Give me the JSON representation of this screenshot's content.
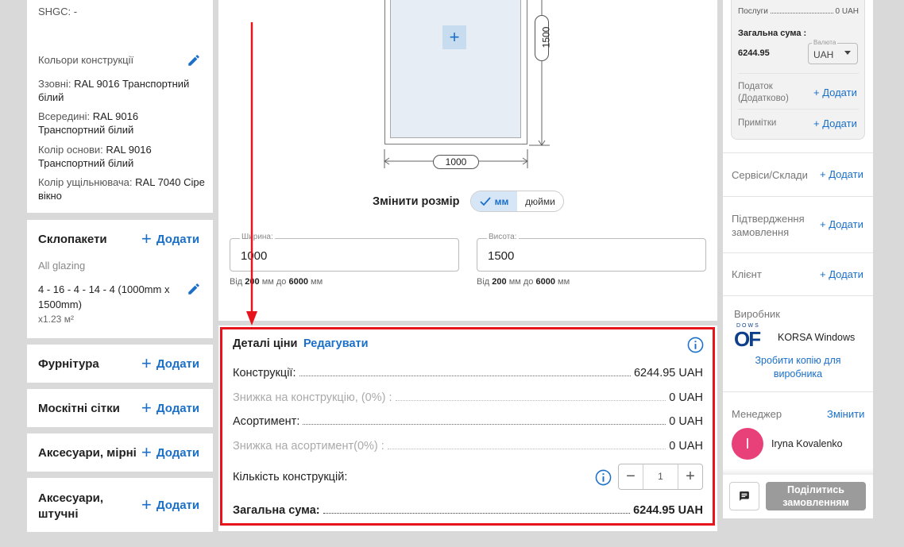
{
  "left": {
    "shgc": "SHGC: -",
    "colors": {
      "title": "Кольори конструкції",
      "outside_label": "Ззовні:",
      "outside_value": "RAL 9016 Транспортний",
      "outside_value2": "білий",
      "inside_label": "Всередині:",
      "inside_value": "RAL 9016",
      "inside_value2": "Транспортний білий",
      "base_label": "Колір основи:",
      "base_value": "RAL 9016",
      "base_value2": "Транспортний білий",
      "seal_label": "Колір ущільнювача:",
      "seal_value": "RAL 7040 Сіре",
      "seal_value2": "вікно"
    },
    "glazing": {
      "title": "Склопакети",
      "add": "Додати",
      "subtitle": "All glazing",
      "spec1": "4 - 16 - 4 - 14 - 4 (1000mm x",
      "spec2": "1500mm)",
      "qty": "x1.23 м²"
    },
    "hardware": {
      "title": "Фурнітура",
      "add": "Додати"
    },
    "mosquito": {
      "title": "Москітні сітки",
      "add": "Додати"
    },
    "acc_measured": {
      "title": "Аксесуари, мірні",
      "add": "Додати"
    },
    "acc_piece": {
      "title1": "Аксесуари,",
      "title2": "штучні",
      "add": "Додати"
    }
  },
  "center": {
    "dim_height": "1500",
    "dim_width": "1000",
    "resize_label": "Змінити розмір",
    "unit_mm": "мм",
    "unit_inch": "дюйми",
    "width_field": {
      "label": "Ширина:",
      "value": "1000",
      "hint_from": "Від",
      "hint_min": "200",
      "hint_mid": "мм до",
      "hint_max": "6000",
      "hint_unit": "мм"
    },
    "height_field": {
      "label": "Висота:",
      "value": "1500",
      "hint_from": "Від",
      "hint_min": "200",
      "hint_mid": "мм до",
      "hint_max": "6000",
      "hint_unit": "мм"
    },
    "price": {
      "title": "Деталі ціни",
      "edit": "Редагувати",
      "constructions_label": "Конструкції:",
      "constructions_value": "6244.95 UAH",
      "construction_discount_label": "Знижка на конструкцію, (0%) :",
      "construction_discount_value": "0 UAH",
      "assortment_label": "Асортимент:",
      "assortment_value": "0 UAH",
      "assortment_discount_label": "Знижка на асортимент(0%) :",
      "assortment_discount_value": "0 UAH",
      "quantity_label": "Кількість конструкцій:",
      "quantity_value": "1",
      "total_label": "Загальна сума:",
      "total_value": "6244.95 UAH"
    }
  },
  "right": {
    "services_label": "Послуги",
    "services_value": "0 UAH",
    "total_label": "Загальна сума :",
    "total_value": "6244.95",
    "currency_label": "Валюта",
    "currency_value": "UAH",
    "tax_label1": "Податок",
    "tax_label2": "(Додатково)",
    "tax_add": "+ Додати",
    "notes_label": "Примітки",
    "notes_add": "+ Додати",
    "services_warehouses": "Сервіси/Склади",
    "services_warehouses_add": "+ Додати",
    "order_confirm1": "Підтвердження",
    "order_confirm2": "замовлення",
    "order_confirm_add": "+ Додати",
    "client": "Клієнт",
    "client_add": "+ Додати",
    "manufacturer": "Виробник",
    "manufacturer_logo_top": "DOWS",
    "manufacturer_logo": "OF",
    "manufacturer_name": "KORSA Windows",
    "copy_link1": "Зробити копію для",
    "copy_link2": "виробника",
    "manager": "Менеджер",
    "manager_change": "Змінити",
    "manager_initial": "I",
    "manager_name": "Iryna Kovalenko",
    "share1": "Поділитись",
    "share2": "замовленням"
  },
  "colors": {
    "accent": "#1a6fc9",
    "highlight": "#e8141b",
    "avatar": "#e8417a"
  }
}
